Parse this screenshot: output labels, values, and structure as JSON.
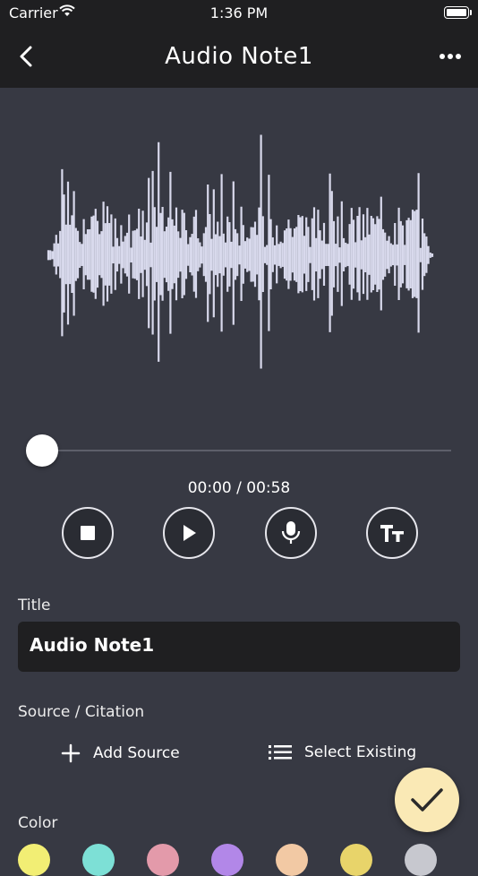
{
  "status_bar": {
    "carrier": "Carrier",
    "time": "1:36 PM"
  },
  "nav": {
    "title": "Audio Note1"
  },
  "player": {
    "time_readout": "00:00 / 00:58",
    "progress": 0
  },
  "form": {
    "title_label": "Title",
    "title_value": "Audio Note1",
    "source_label": "Source / Citation",
    "add_source": "Add Source",
    "select_existing": "Select Existing",
    "color_label": "Color"
  },
  "colors": {
    "background": "#373943",
    "bar": "#1f1f21",
    "waveform": "#d8d9ec",
    "fab": "#fae9b5",
    "swatches": [
      "#f2ee74",
      "#7de0d6",
      "#e39aaa",
      "#b287e8",
      "#f2c9a4",
      "#e8d46a",
      "#c7c8cf"
    ]
  },
  "icons": {
    "back": "chevron-left-icon",
    "more": "more-horizontal-icon",
    "stop": "stop-icon",
    "play": "play-icon",
    "mic": "microphone-icon",
    "text": "text-size-icon",
    "add": "plus-icon",
    "list": "list-icon",
    "confirm": "checkmark-icon"
  }
}
